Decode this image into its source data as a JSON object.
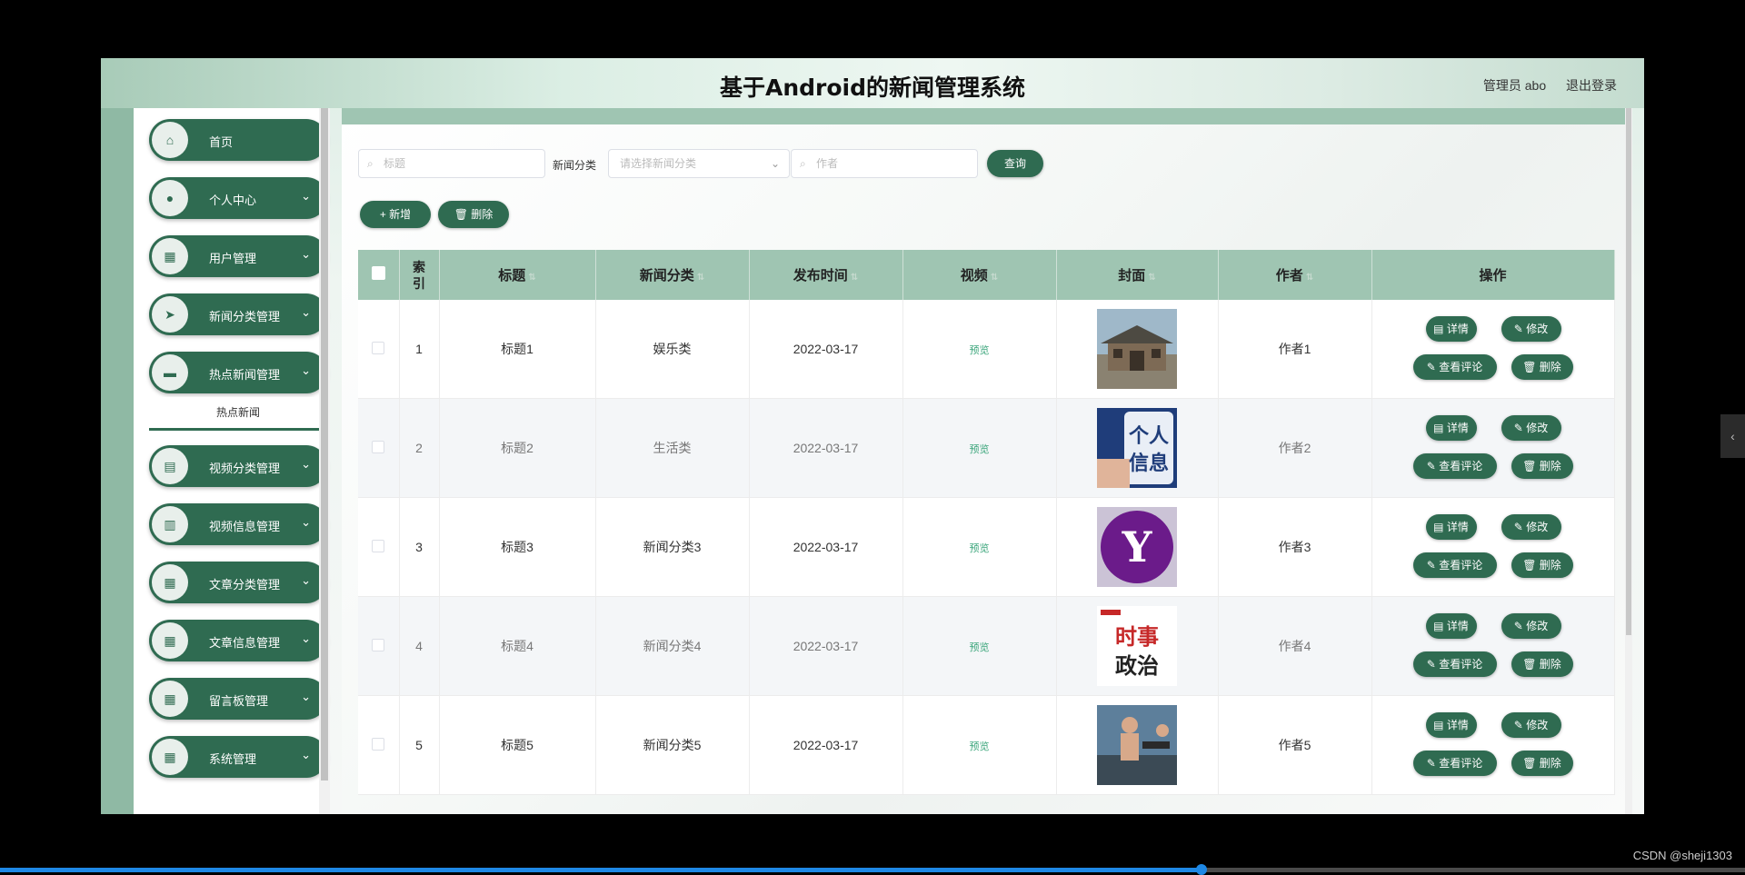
{
  "header": {
    "title": "基于Android的新闻管理系统",
    "user": "管理员 abo",
    "logout": "退出登录"
  },
  "sidebar": {
    "items": [
      {
        "label": "首页",
        "icon": "home-icon",
        "glyph": "⌂",
        "has_chevron": false
      },
      {
        "label": "个人中心",
        "icon": "user-icon",
        "glyph": "●",
        "has_chevron": true
      },
      {
        "label": "用户管理",
        "icon": "grid-icon",
        "glyph": "▦",
        "has_chevron": true
      },
      {
        "label": "新闻分类管理",
        "icon": "send-icon",
        "glyph": "➤",
        "has_chevron": true
      },
      {
        "label": "热点新闻管理",
        "icon": "ticket-icon",
        "glyph": "▬",
        "has_chevron": true
      },
      {
        "label": "视频分类管理",
        "icon": "chat-icon",
        "glyph": "▤",
        "has_chevron": true
      },
      {
        "label": "视频信息管理",
        "icon": "clipboard-icon",
        "glyph": "▥",
        "has_chevron": true
      },
      {
        "label": "文章分类管理",
        "icon": "grid-icon",
        "glyph": "▦",
        "has_chevron": true
      },
      {
        "label": "文章信息管理",
        "icon": "grid-icon",
        "glyph": "▦",
        "has_chevron": true
      },
      {
        "label": "留言板管理",
        "icon": "grid-icon",
        "glyph": "▦",
        "has_chevron": true
      },
      {
        "label": "系统管理",
        "icon": "grid-icon",
        "glyph": "▦",
        "has_chevron": true
      }
    ],
    "submenu": "热点新闻"
  },
  "search": {
    "title_placeholder": "标题",
    "category_label": "新闻分类",
    "category_placeholder": "请选择新闻分类",
    "author_placeholder": "作者",
    "query_button": "查询"
  },
  "toolbar": {
    "add_button": "+ 新增",
    "delete_button": "删除"
  },
  "table": {
    "headers": {
      "index": "索引",
      "title": "标题",
      "category": "新闻分类",
      "date": "发布时间",
      "video": "视频",
      "cover": "封面",
      "author": "作者",
      "actions": "操作"
    },
    "rows": [
      {
        "index": "1",
        "title": "标题1",
        "category": "娱乐类",
        "date": "2022-03-17",
        "video": "预览",
        "cover": "building",
        "author": "作者1"
      },
      {
        "index": "2",
        "title": "标题2",
        "category": "生活类",
        "date": "2022-03-17",
        "video": "预览",
        "cover": "personal-info",
        "cover_text": "个人信息",
        "author": "作者2"
      },
      {
        "index": "3",
        "title": "标题3",
        "category": "新闻分类3",
        "date": "2022-03-17",
        "video": "预览",
        "cover": "yahoo-logo",
        "cover_text": "Y",
        "author": "作者3"
      },
      {
        "index": "4",
        "title": "标题4",
        "category": "新闻分类4",
        "date": "2022-03-17",
        "video": "预览",
        "cover": "politics",
        "cover_text": "时事政治",
        "author": "作者4"
      },
      {
        "index": "5",
        "title": "标题5",
        "category": "新闻分类5",
        "date": "2022-03-17",
        "video": "预览",
        "cover": "gym",
        "author": "作者5"
      }
    ],
    "row_actions": {
      "detail": "详情",
      "edit": "修改",
      "comments": "查看评论",
      "delete": "删除"
    }
  },
  "overlay": {
    "watermark": "CSDN @sheji1303"
  },
  "colors": {
    "primary": "#2f6b51",
    "header_row": "#9fc5b2",
    "preview_link": "#3aa57a"
  }
}
